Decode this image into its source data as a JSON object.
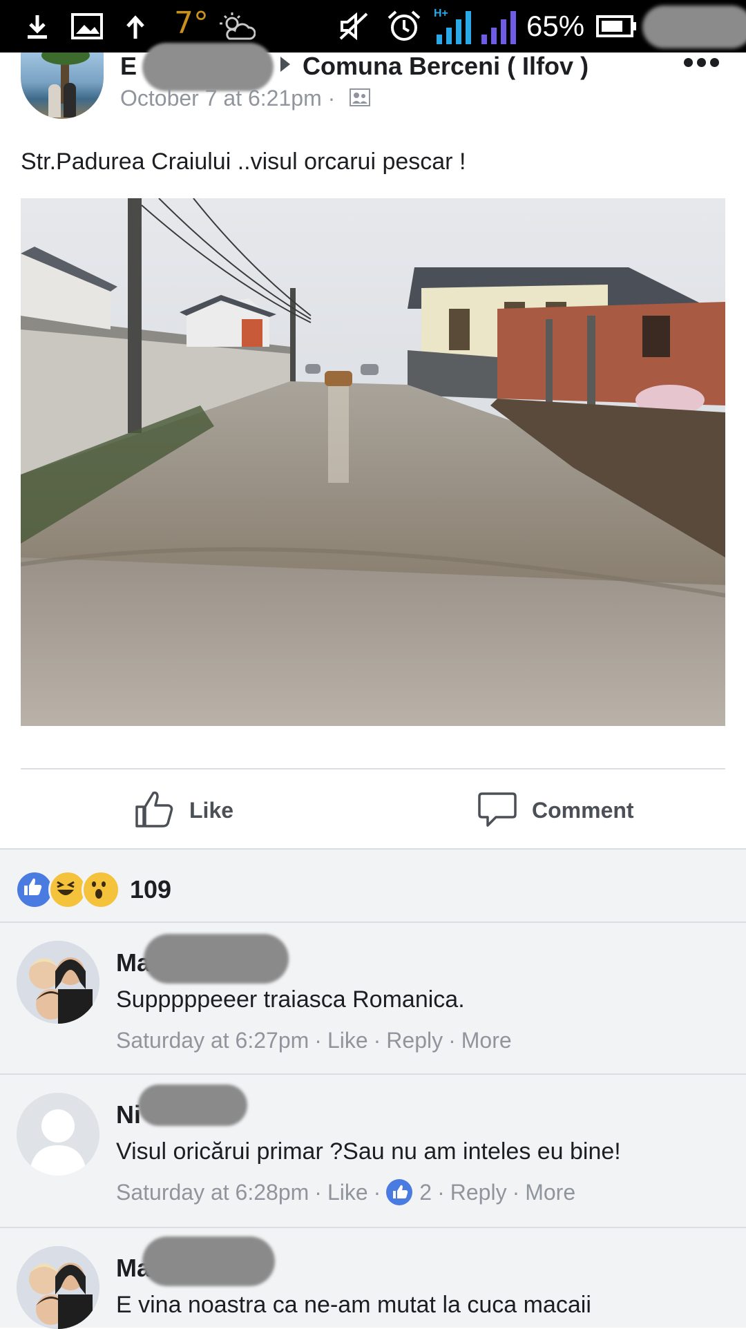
{
  "status_bar": {
    "temperature": "7°",
    "network": "H+",
    "battery_percent": "65%",
    "icons": [
      "download-icon",
      "image-icon",
      "upload-icon",
      "weather-icon",
      "mute-icon",
      "alarm-icon",
      "signal-icon",
      "battery-icon"
    ]
  },
  "post": {
    "author_initial": "E",
    "group": "Comuna Berceni ( Ilfov )",
    "time": "October 7 at 6:21pm",
    "time_separator": "·",
    "text": "Str.Padurea Craiului ..visul orcarui pescar !"
  },
  "actions": {
    "like_label": "Like",
    "comment_label": "Comment"
  },
  "reactions": {
    "types": [
      "like",
      "haha",
      "wow"
    ],
    "count": "109"
  },
  "comments": [
    {
      "name_initial": "Ma",
      "text": "Supppppeeer traiasca Romanica.",
      "time": "Saturday at 6:27pm",
      "like": "Like",
      "reply": "Reply",
      "more": "More",
      "like_count": ""
    },
    {
      "name_initial": "Ni",
      "text": "Visul oricărui primar ?Sau nu am inteles eu bine!",
      "time": "Saturday at 6:28pm",
      "like": "Like",
      "reply": "Reply",
      "more": "More",
      "like_count": "2"
    },
    {
      "name_initial": "Ma",
      "text": "E vina noastra ca ne-am mutat la cuca macaii"
    }
  ],
  "colors": {
    "accent_blue": "#4a7be0",
    "meta_gray": "#90949c",
    "comments_bg": "#f2f3f5"
  }
}
